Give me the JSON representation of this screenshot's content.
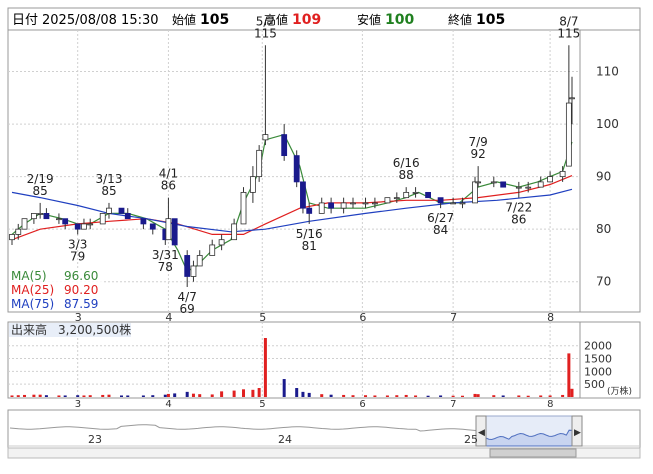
{
  "header": {
    "date_label": "日付",
    "datetime": "2025/08/08 15:30",
    "open_label": "始値",
    "open": "105",
    "high_label": "高値",
    "high": "109",
    "low_label": "安値",
    "low": "100",
    "close_label": "終値",
    "close": "105"
  },
  "colors": {
    "up_body": "#ffffff",
    "down_body": "#1a1a8c",
    "candle_line": "#333333",
    "ma5": "#3a8a3a",
    "ma25": "#e02020",
    "ma75": "#2040c0",
    "volume": "#1a1a8c",
    "volume_up": "#e02020",
    "volume_down": "#1a1a8c",
    "grid": "#d0d0d0",
    "navigator_fill": "#c8d4f0",
    "navigator_line": "#5070c0",
    "high_value": "#e02020",
    "low_value": "#208020"
  },
  "chart_data": [
    {
      "type": "candlestick",
      "x_axis": "date",
      "y_ticks": [
        70,
        80,
        90,
        100,
        110
      ],
      "ylim": [
        65,
        116
      ],
      "x_tick_labels": [
        "3",
        "4",
        "5",
        "6",
        "7",
        "8"
      ],
      "x_tick_dates": [
        "2025-03-03",
        "2025-04-01",
        "2025-05-01",
        "2025-06-02",
        "2025-07-01",
        "2025-08-01"
      ],
      "start_date": "2025-02-10",
      "end_date": "2025-08-08",
      "series": [
        {
          "name": "MA(5)",
          "value": "96.60",
          "color": "#3a8a3a"
        },
        {
          "name": "MA(25)",
          "value": "90.20",
          "color": "#e02020"
        },
        {
          "name": "MA(75)",
          "value": "87.59",
          "color": "#2040c0"
        }
      ],
      "ma_paths": {
        "ma5": [
          [
            "2025-02-10",
            79
          ],
          [
            "2025-02-14",
            81
          ],
          [
            "2025-02-19",
            83
          ],
          [
            "2025-02-26",
            82
          ],
          [
            "2025-03-03",
            81
          ],
          [
            "2025-03-07",
            81
          ],
          [
            "2025-03-13",
            83
          ],
          [
            "2025-03-19",
            83
          ],
          [
            "2025-03-25",
            82
          ],
          [
            "2025-03-31",
            80
          ],
          [
            "2025-04-04",
            76
          ],
          [
            "2025-04-07",
            72
          ],
          [
            "2025-04-10",
            73
          ],
          [
            "2025-04-15",
            76
          ],
          [
            "2025-04-21",
            78
          ],
          [
            "2025-04-25",
            85
          ],
          [
            "2025-04-30",
            91
          ],
          [
            "2025-05-02",
            97
          ],
          [
            "2025-05-08",
            98
          ],
          [
            "2025-05-13",
            92
          ],
          [
            "2025-05-16",
            85
          ],
          [
            "2025-05-22",
            84
          ],
          [
            "2025-05-28",
            84
          ],
          [
            "2025-06-03",
            84
          ],
          [
            "2025-06-10",
            85
          ],
          [
            "2025-06-16",
            86
          ],
          [
            "2025-06-20",
            87
          ],
          [
            "2025-06-27",
            85
          ],
          [
            "2025-07-03",
            85
          ],
          [
            "2025-07-09",
            88
          ],
          [
            "2025-07-15",
            89
          ],
          [
            "2025-07-22",
            88
          ],
          [
            "2025-07-28",
            89
          ],
          [
            "2025-08-01",
            90
          ],
          [
            "2025-08-05",
            91
          ],
          [
            "2025-08-08",
            96.6
          ]
        ],
        "ma25": [
          [
            "2025-02-10",
            78
          ],
          [
            "2025-02-19",
            80
          ],
          [
            "2025-03-03",
            81
          ],
          [
            "2025-03-13",
            81.5
          ],
          [
            "2025-03-25",
            82
          ],
          [
            "2025-04-04",
            81
          ],
          [
            "2025-04-15",
            79
          ],
          [
            "2025-04-25",
            79
          ],
          [
            "2025-05-02",
            81
          ],
          [
            "2025-05-13",
            84
          ],
          [
            "2025-05-22",
            85
          ],
          [
            "2025-06-03",
            85
          ],
          [
            "2025-06-16",
            85.5
          ],
          [
            "2025-06-27",
            85.5
          ],
          [
            "2025-07-09",
            86
          ],
          [
            "2025-07-22",
            87
          ],
          [
            "2025-08-01",
            88.5
          ],
          [
            "2025-08-08",
            90.2
          ]
        ],
        "ma75": [
          [
            "2025-02-10",
            87
          ],
          [
            "2025-02-19",
            86
          ],
          [
            "2025-03-03",
            84.5
          ],
          [
            "2025-03-13",
            83
          ],
          [
            "2025-03-25",
            82
          ],
          [
            "2025-04-07",
            80.5
          ],
          [
            "2025-04-21",
            79.5
          ],
          [
            "2025-05-02",
            80
          ],
          [
            "2025-05-16",
            81.5
          ],
          [
            "2025-06-03",
            83
          ],
          [
            "2025-06-16",
            84
          ],
          [
            "2025-07-01",
            85
          ],
          [
            "2025-07-15",
            85.5
          ],
          [
            "2025-08-01",
            86.5
          ],
          [
            "2025-08-08",
            87.59
          ]
        ]
      },
      "candles": [
        [
          "2025-02-10",
          78,
          79,
          77,
          79
        ],
        [
          "2025-02-12",
          79,
          81,
          78,
          80
        ],
        [
          "2025-02-14",
          80,
          82,
          80,
          82
        ],
        [
          "2025-02-17",
          82,
          83,
          81,
          83
        ],
        [
          "2025-02-19",
          83,
          85,
          82,
          83
        ],
        [
          "2025-02-21",
          83,
          84,
          82,
          82
        ],
        [
          "2025-02-25",
          82,
          83,
          81,
          82
        ],
        [
          "2025-02-27",
          82,
          82,
          80,
          81
        ],
        [
          "2025-03-03",
          81,
          81,
          79,
          80
        ],
        [
          "2025-03-05",
          80,
          82,
          80,
          81
        ],
        [
          "2025-03-07",
          81,
          82,
          80,
          81
        ],
        [
          "2025-03-11",
          81,
          83,
          81,
          83
        ],
        [
          "2025-03-13",
          83,
          85,
          82,
          84
        ],
        [
          "2025-03-17",
          84,
          84,
          83,
          83
        ],
        [
          "2025-03-19",
          83,
          84,
          82,
          82
        ],
        [
          "2025-03-24",
          82,
          82,
          80,
          81
        ],
        [
          "2025-03-27",
          81,
          81,
          79,
          80
        ],
        [
          "2025-03-31",
          80,
          80,
          77,
          78
        ],
        [
          "2025-04-01",
          78,
          86,
          78,
          82
        ],
        [
          "2025-04-03",
          82,
          82,
          77,
          77
        ],
        [
          "2025-04-07",
          75,
          76,
          69,
          71
        ],
        [
          "2025-04-09",
          71,
          74,
          70,
          73
        ],
        [
          "2025-04-11",
          73,
          76,
          73,
          75
        ],
        [
          "2025-04-15",
          75,
          78,
          75,
          77
        ],
        [
          "2025-04-18",
          77,
          79,
          76,
          78
        ],
        [
          "2025-04-22",
          78,
          82,
          78,
          81
        ],
        [
          "2025-04-25",
          81,
          88,
          81,
          87
        ],
        [
          "2025-04-28",
          87,
          92,
          85,
          90
        ],
        [
          "2025-04-30",
          90,
          96,
          89,
          95
        ],
        [
          "2025-05-02",
          97,
          115,
          96,
          98
        ],
        [
          "2025-05-08",
          98,
          100,
          93,
          94
        ],
        [
          "2025-05-12",
          94,
          95,
          88,
          89
        ],
        [
          "2025-05-14",
          89,
          89,
          83,
          84
        ],
        [
          "2025-05-16",
          84,
          85,
          81,
          83
        ],
        [
          "2025-05-20",
          83,
          86,
          83,
          85
        ],
        [
          "2025-05-23",
          85,
          86,
          83,
          84
        ],
        [
          "2025-05-27",
          84,
          86,
          83,
          85
        ],
        [
          "2025-05-30",
          85,
          86,
          84,
          85
        ],
        [
          "2025-06-03",
          85,
          86,
          84,
          85
        ],
        [
          "2025-06-06",
          85,
          86,
          84,
          85
        ],
        [
          "2025-06-10",
          85,
          86,
          85,
          86
        ],
        [
          "2025-06-13",
          86,
          87,
          85,
          86
        ],
        [
          "2025-06-16",
          86,
          88,
          86,
          87
        ],
        [
          "2025-06-19",
          87,
          88,
          86,
          87
        ],
        [
          "2025-06-23",
          87,
          87,
          86,
          86
        ],
        [
          "2025-06-27",
          86,
          86,
          84,
          85
        ],
        [
          "2025-07-01",
          85,
          86,
          85,
          85
        ],
        [
          "2025-07-04",
          85,
          86,
          84,
          85
        ],
        [
          "2025-07-08",
          85,
          90,
          85,
          89
        ],
        [
          "2025-07-09",
          89,
          92,
          88,
          89
        ],
        [
          "2025-07-14",
          89,
          90,
          88,
          89
        ],
        [
          "2025-07-17",
          89,
          89,
          88,
          88
        ],
        [
          "2025-07-22",
          88,
          89,
          86,
          88
        ],
        [
          "2025-07-25",
          88,
          89,
          87,
          88
        ],
        [
          "2025-07-29",
          88,
          90,
          88,
          89
        ],
        [
          "2025-08-01",
          89,
          91,
          89,
          90
        ],
        [
          "2025-08-05",
          90,
          92,
          89,
          91
        ],
        [
          "2025-08-07",
          92,
          115,
          92,
          104
        ],
        [
          "2025-08-08",
          105,
          109,
          100,
          105
        ]
      ],
      "annotations": [
        {
          "date": "2025-02-19",
          "price": 85,
          "date_label": "2/19",
          "value_label": "85",
          "position": "above"
        },
        {
          "date": "2025-03-03",
          "price": 79,
          "date_label": "3/3",
          "value_label": "79",
          "position": "below"
        },
        {
          "date": "2025-03-13",
          "price": 85,
          "date_label": "3/13",
          "value_label": "85",
          "position": "above"
        },
        {
          "date": "2025-03-31",
          "price": 77,
          "date_label": "3/31",
          "value_label": "78",
          "position": "below"
        },
        {
          "date": "2025-04-01",
          "price": 86,
          "date_label": "4/1",
          "value_label": "86",
          "position": "above"
        },
        {
          "date": "2025-04-07",
          "price": 69,
          "date_label": "4/7",
          "value_label": "69",
          "position": "below"
        },
        {
          "date": "2025-05-02",
          "price": 115,
          "date_label": "5/2",
          "value_label": "115",
          "position": "above"
        },
        {
          "date": "2025-05-16",
          "price": 81,
          "date_label": "5/16",
          "value_label": "81",
          "position": "below"
        },
        {
          "date": "2025-06-16",
          "price": 88,
          "date_label": "6/16",
          "value_label": "88",
          "position": "above"
        },
        {
          "date": "2025-06-27",
          "price": 84,
          "date_label": "6/27",
          "value_label": "84",
          "position": "below"
        },
        {
          "date": "2025-07-09",
          "price": 92,
          "date_label": "7/9",
          "value_label": "92",
          "position": "above"
        },
        {
          "date": "2025-07-22",
          "price": 86,
          "date_label": "7/22",
          "value_label": "86",
          "position": "below"
        },
        {
          "date": "2025-08-07",
          "price": 115,
          "date_label": "8/7",
          "value_label": "115",
          "position": "above"
        }
      ]
    },
    {
      "type": "bar",
      "title": "出来高",
      "latest_volume": "3,200,500株",
      "y_ticks": [
        500,
        1000,
        1500,
        2000
      ],
      "ylim": [
        0,
        2300
      ],
      "unit": "(万株)",
      "x_tick_labels": [
        "3",
        "4",
        "5",
        "6",
        "7",
        "8"
      ],
      "bars": [
        [
          "2025-02-10",
          60
        ],
        [
          "2025-02-12",
          70
        ],
        [
          "2025-02-14",
          80
        ],
        [
          "2025-02-17",
          90
        ],
        [
          "2025-02-19",
          90
        ],
        [
          "2025-02-21",
          70
        ],
        [
          "2025-02-25",
          60
        ],
        [
          "2025-02-27",
          60
        ],
        [
          "2025-03-03",
          70
        ],
        [
          "2025-03-05",
          60
        ],
        [
          "2025-03-07",
          70
        ],
        [
          "2025-03-11",
          80
        ],
        [
          "2025-03-13",
          90
        ],
        [
          "2025-03-17",
          60
        ],
        [
          "2025-03-19",
          60
        ],
        [
          "2025-03-24",
          60
        ],
        [
          "2025-03-27",
          70
        ],
        [
          "2025-03-31",
          90
        ],
        [
          "2025-04-01",
          120
        ],
        [
          "2025-04-03",
          140
        ],
        [
          "2025-04-07",
          200
        ],
        [
          "2025-04-09",
          130
        ],
        [
          "2025-04-11",
          110
        ],
        [
          "2025-04-15",
          100
        ],
        [
          "2025-04-18",
          220
        ],
        [
          "2025-04-22",
          250
        ],
        [
          "2025-04-25",
          300
        ],
        [
          "2025-04-28",
          280
        ],
        [
          "2025-04-30",
          350
        ],
        [
          "2025-05-02",
          2300
        ],
        [
          "2025-05-08",
          700
        ],
        [
          "2025-05-12",
          350
        ],
        [
          "2025-05-14",
          200
        ],
        [
          "2025-05-16",
          160
        ],
        [
          "2025-05-20",
          110
        ],
        [
          "2025-05-23",
          90
        ],
        [
          "2025-05-27",
          80
        ],
        [
          "2025-05-30",
          70
        ],
        [
          "2025-06-03",
          70
        ],
        [
          "2025-06-06",
          60
        ],
        [
          "2025-06-10",
          60
        ],
        [
          "2025-06-13",
          70
        ],
        [
          "2025-06-16",
          80
        ],
        [
          "2025-06-19",
          60
        ],
        [
          "2025-06-23",
          50
        ],
        [
          "2025-06-27",
          60
        ],
        [
          "2025-07-01",
          50
        ],
        [
          "2025-07-04",
          50
        ],
        [
          "2025-07-08",
          120
        ],
        [
          "2025-07-09",
          110
        ],
        [
          "2025-07-14",
          70
        ],
        [
          "2025-07-17",
          60
        ],
        [
          "2025-07-22",
          60
        ],
        [
          "2025-07-25",
          50
        ],
        [
          "2025-07-29",
          60
        ],
        [
          "2025-08-01",
          60
        ],
        [
          "2025-08-05",
          80
        ],
        [
          "2025-08-07",
          1700
        ],
        [
          "2025-08-08",
          320
        ]
      ]
    }
  ],
  "navigator": {
    "labels": [
      "23",
      "24",
      "25"
    ],
    "left_handle": "◀",
    "right_handle": "▶"
  }
}
